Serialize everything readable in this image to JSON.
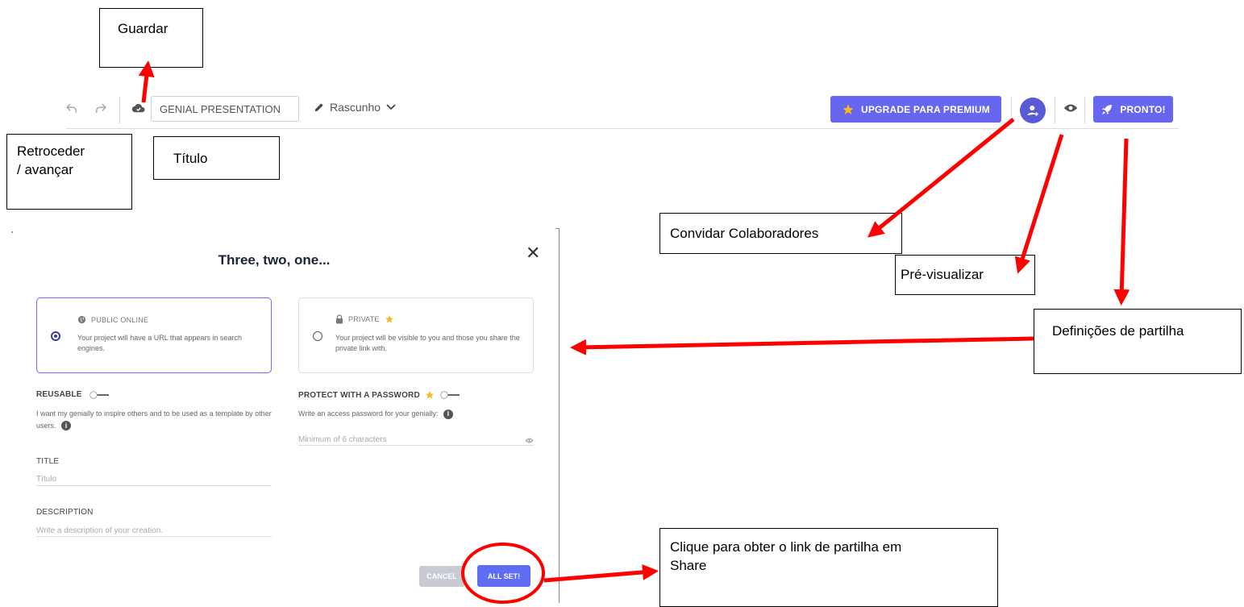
{
  "toolbar": {
    "title_value": "GENIAL PRESENTATION",
    "status_label": "Rascunho",
    "upgrade_label": "UPGRADE PARA PREMIUM",
    "done_label": "PRONTO!"
  },
  "annotations": {
    "save": "Guardar",
    "undo_redo_line1": "Retroceder",
    "undo_redo_line2": "/ avançar",
    "title": "Título",
    "invite": "Convidar Colaboradores",
    "preview": "Pré-visualizar",
    "share_settings": "Definições de partilha",
    "click_share_line1": "Clique para obter o link de partilha em",
    "click_share_line2": "Share"
  },
  "dialog": {
    "title": "Three, two, one...",
    "public_title": "PUBLIC ONLINE",
    "public_text": "Your project will have a URL that appears in search engines.",
    "private_title": "PRIVATE",
    "private_text": "Your project will be visible to you and those you share the private link with.",
    "reusable_label": "REUSABLE",
    "reusable_text": "I want my genially to inspire others and to be used as a template by other users.",
    "password_label": "PROTECT WITH A PASSWORD",
    "password_text": "Write an access password for your genially:",
    "password_placeholder": "Minimum of 6 characters",
    "title_label": "TITLE",
    "title_placeholder": "Título",
    "description_label": "DESCRIPTION",
    "description_placeholder": "Write a description of your creation.",
    "cancel_label": "CANCEL",
    "allset_label": "ALL SET!"
  },
  "colors": {
    "accent": "#6666f0",
    "arrow": "#ff0000",
    "star": "#f5b922"
  },
  "icons": {
    "undo": "undo-icon",
    "redo": "redo-icon",
    "save": "cloud-save-icon",
    "edit": "pencil-icon",
    "dropdown": "chevron-down-icon",
    "star": "star-icon",
    "invite": "add-user-icon",
    "preview": "eye-icon",
    "publish": "rocket-icon"
  }
}
